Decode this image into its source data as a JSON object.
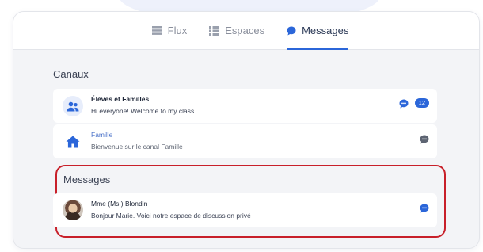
{
  "tabs": [
    {
      "label": "Flux",
      "icon": "feed-icon",
      "active": false
    },
    {
      "label": "Espaces",
      "icon": "spaces-icon",
      "active": false
    },
    {
      "label": "Messages",
      "icon": "message-bubble-icon",
      "active": true
    }
  ],
  "channels": {
    "title": "Canaux",
    "items": [
      {
        "name": "Élèves et Familles",
        "preview": "Hi everyone! Welcome to my class",
        "icon": "group-icon",
        "badge": "12",
        "status_icon": "chat-dots-icon"
      },
      {
        "name": "Famille",
        "preview": "Bienvenue sur le canal Famille",
        "icon": "home-icon",
        "status_icon": "chat-dots-icon"
      }
    ]
  },
  "messages": {
    "title": "Messages",
    "items": [
      {
        "name": "Mme (Ms.) Blondin",
        "preview": "Bonjour Marie. Voici notre espace de discussion privé",
        "icon": "user-photo-avatar",
        "status_icon": "chat-dots-icon"
      }
    ]
  },
  "colors": {
    "accent": "#2b66d9",
    "highlight": "#c8202a",
    "background": "#f3f4f7"
  }
}
